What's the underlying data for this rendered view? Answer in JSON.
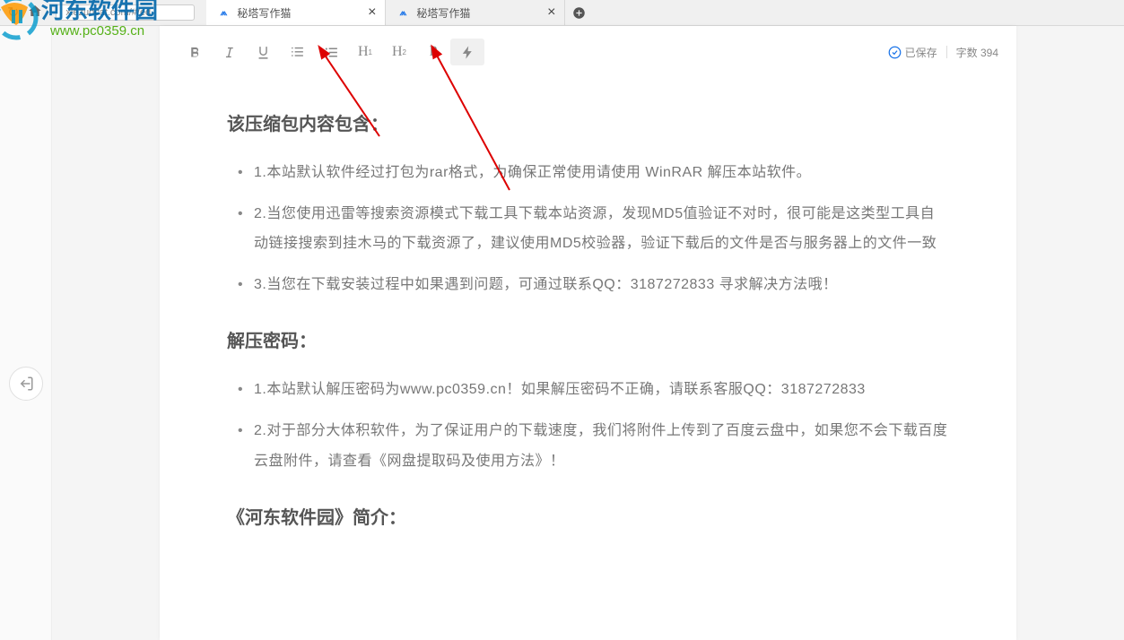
{
  "browser": {
    "url": "xiezuocat.com/#/ed"
  },
  "tabs": [
    {
      "title": "秘塔写作猫",
      "active": true
    },
    {
      "title": "秘塔写作猫",
      "active": false
    }
  ],
  "status": {
    "saved": "已保存",
    "word_label": "字数",
    "word_count": "394"
  },
  "document": {
    "h1": "该压缩包内容包含：",
    "list1": [
      "1.本站默认软件经过打包为rar格式，为确保正常使用请使用 WinRAR 解压本站软件。",
      "2.当您使用迅雷等搜索资源模式下载工具下载本站资源，发现MD5值验证不对时，很可能是这类型工具自动链接搜索到挂木马的下载资源了，建议使用MD5校验器，验证下载后的文件是否与服务器上的文件一致",
      "3.当您在下载安装过程中如果遇到问题，可通过联系QQ：3187272833 寻求解决方法哦！"
    ],
    "h2": "解压密码：",
    "list2": [
      "1.本站默认解压密码为www.pc0359.cn！如果解压密码不正确，请联系客服QQ：3187272833",
      "2.对于部分大体积软件，为了保证用户的下载速度，我们将附件上传到了百度云盘中，如果您不会下载百度云盘附件，请查看《网盘提取码及使用方法》！"
    ],
    "h3": "《河东软件园》简介："
  },
  "watermark": {
    "line1": "河东软件园",
    "line2": "www.pc0359.cn"
  }
}
